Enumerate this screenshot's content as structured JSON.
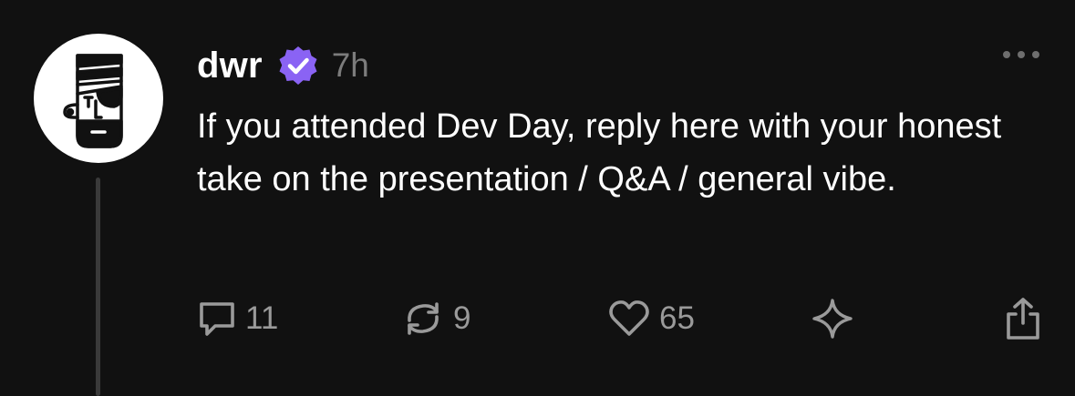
{
  "post": {
    "author": {
      "username": "dwr",
      "verified": true,
      "avatar_icon": "pirate-face-avatar"
    },
    "timestamp": "7h",
    "text": "If you attended Dev Day, reply here with your honest take on the presentation / Q&A / general vibe.",
    "more_icon": "ellipsis-icon",
    "actions": {
      "replies": "11",
      "recasts": "9",
      "likes": "65",
      "tip_icon": "sparkle-icon",
      "share_icon": "share-icon"
    }
  },
  "colors": {
    "background": "#111111",
    "text": "#ffffff",
    "muted": "#7c7c7c",
    "icon": "#9a9a9a",
    "verified_badge": "#8a63f4",
    "thread_line": "#3a3a3a"
  }
}
